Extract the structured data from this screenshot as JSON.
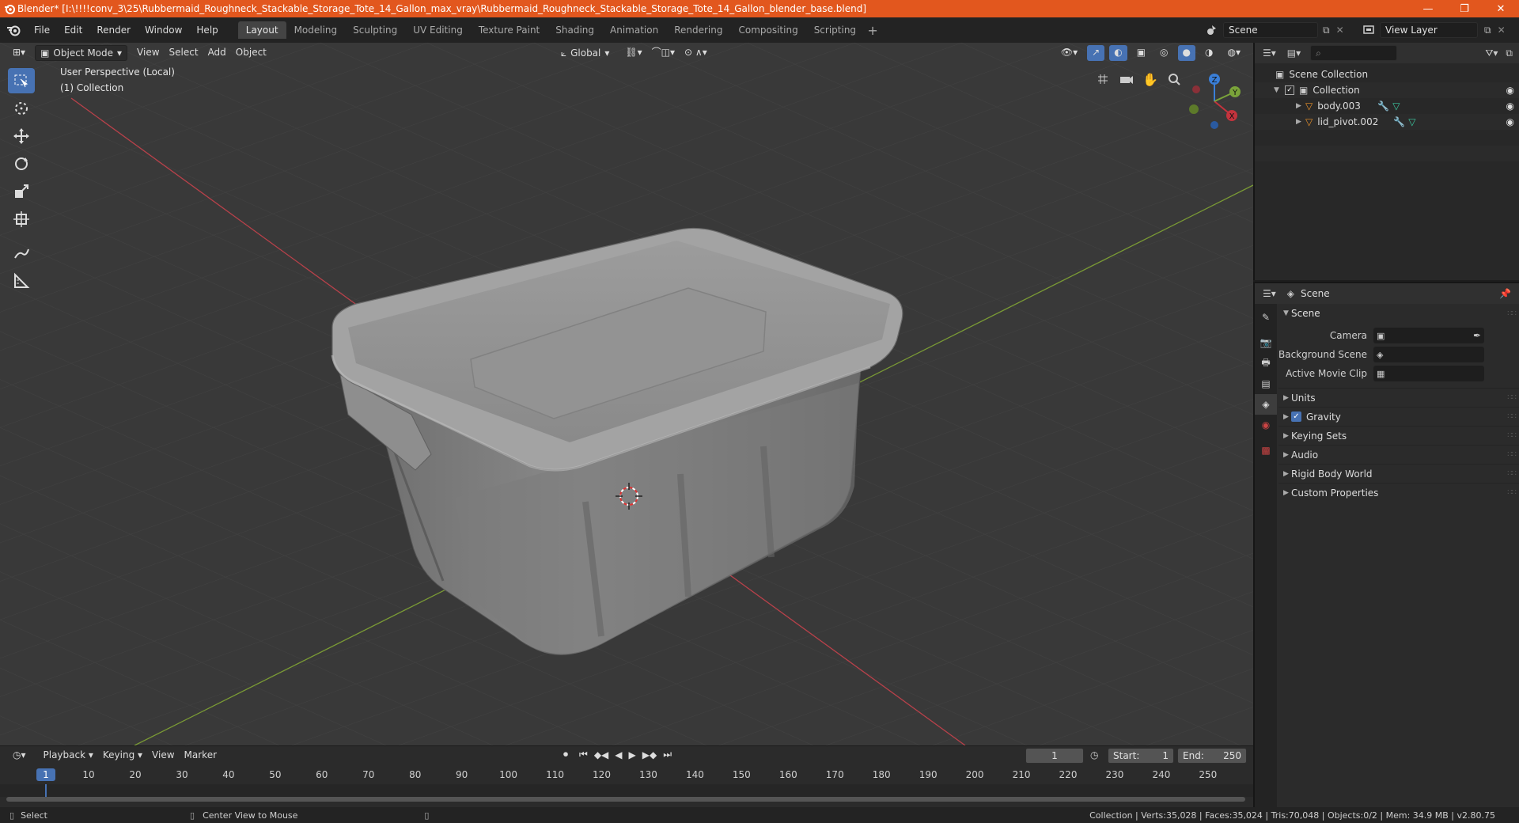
{
  "window": {
    "title": "Blender* [I:\\!!!!conv_3\\25\\Rubbermaid_Roughneck_Stackable_Storage_Tote_14_Gallon_max_vray\\Rubbermaid_Roughneck_Stackable_Storage_Tote_14_Gallon_blender_base.blend]",
    "minimize": "—",
    "maximize": "❐",
    "close": "✕"
  },
  "menu": [
    "File",
    "Edit",
    "Render",
    "Window",
    "Help"
  ],
  "workspaces": [
    "Layout",
    "Modeling",
    "Sculpting",
    "UV Editing",
    "Texture Paint",
    "Shading",
    "Animation",
    "Rendering",
    "Compositing",
    "Scripting"
  ],
  "active_workspace": "Layout",
  "scene_selector": "Scene",
  "view_layer_selector": "View Layer",
  "viewport": {
    "mode": "Object Mode",
    "menus": [
      "View",
      "Select",
      "Add",
      "Object"
    ],
    "orientation": "Global",
    "view_name": "User Perspective (Local)",
    "collection_label": "(1) Collection"
  },
  "gizmo": {
    "x": "X",
    "y": "Y",
    "z": "Z"
  },
  "outliner": {
    "root": "Scene Collection",
    "collection": "Collection",
    "objects": [
      "body.003",
      "lid_pivot.002"
    ]
  },
  "properties": {
    "header": "Scene",
    "panel": "Scene",
    "fields": [
      {
        "label": "Camera",
        "value": ""
      },
      {
        "label": "Background Scene",
        "value": ""
      },
      {
        "label": "Active Movie Clip",
        "value": ""
      }
    ],
    "subpanels": [
      "Units",
      "Gravity",
      "Keying Sets",
      "Audio",
      "Rigid Body World",
      "Custom Properties"
    ]
  },
  "timeline": {
    "menus": [
      "Playback",
      "Keying",
      "View",
      "Marker"
    ],
    "current_frame": "1",
    "start_label": "Start:",
    "start": "1",
    "end_label": "End:",
    "end": "250",
    "ticks": [
      "10",
      "20",
      "30",
      "40",
      "50",
      "60",
      "70",
      "80",
      "90",
      "100",
      "110",
      "120",
      "130",
      "140",
      "150",
      "160",
      "170",
      "180",
      "190",
      "200",
      "210",
      "220",
      "230",
      "240",
      "250"
    ]
  },
  "status": {
    "left": "Select",
    "middle": "Center View to Mouse",
    "right": "Collection | Verts:35,028 | Faces:35,024 | Tris:70,048 | Objects:0/2 | Mem: 34.9 MB | v2.80.75"
  },
  "colors": {
    "title_bar": "#e2571e",
    "accent": "#4772b3",
    "x_axis": "#c4333d",
    "y_axis": "#7aa33a",
    "z_axis": "#3a7fd8"
  }
}
